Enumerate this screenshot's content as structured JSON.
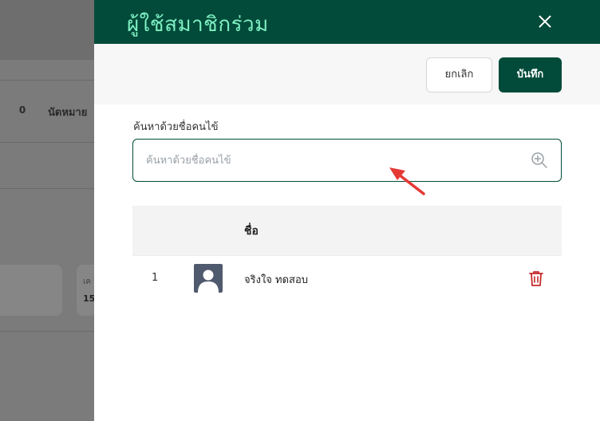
{
  "background": {
    "tab_count": "0",
    "tab_label": "นัดหมาย",
    "card_sub": "เค",
    "card_num": "15"
  },
  "drawer": {
    "title": "ผู้ใช้สมาชิกร่วม",
    "cancel_label": "ยกเลิก",
    "save_label": "บันทึก",
    "search_label": "ค้นหาด้วยชื่อคนไข้",
    "search_placeholder": "ค้นหาด้วยชื่อคนไข้",
    "search_value": ""
  },
  "table": {
    "column_name": "ชื่อ",
    "rows": [
      {
        "index": "1",
        "name": "จริงใจ ทดสอบ"
      }
    ]
  },
  "colors": {
    "primary": "#024b3a",
    "title_accent": "#7ff0c2",
    "delete": "#c62828",
    "annotation_arrow": "#e53935"
  }
}
